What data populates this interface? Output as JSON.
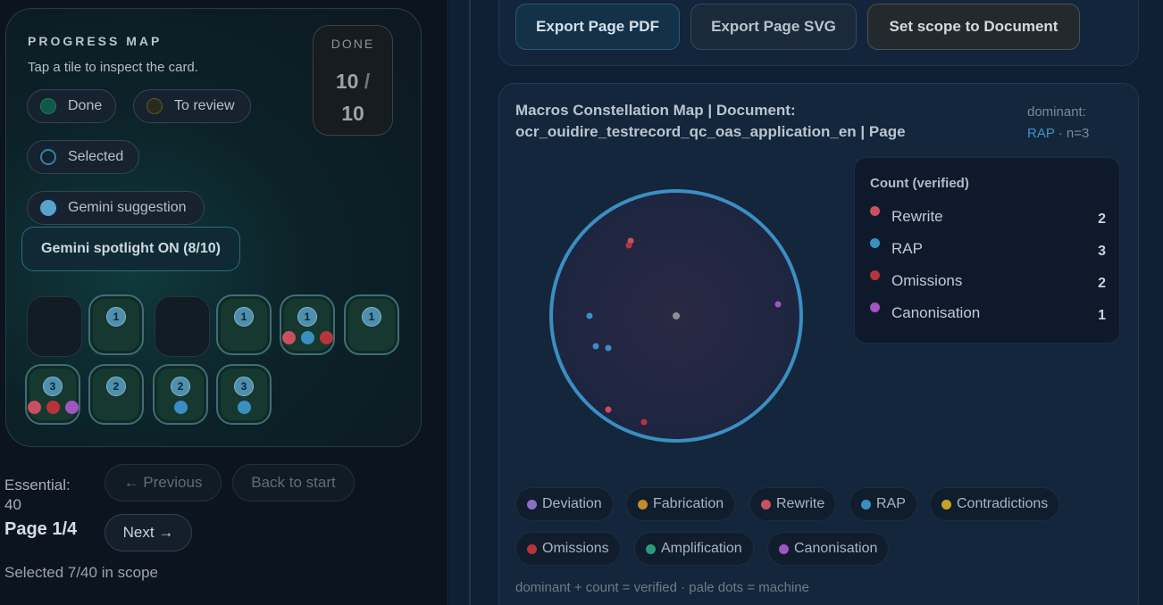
{
  "progress_map": {
    "title": "PROGRESS MAP",
    "subtitle": "Tap a tile to inspect the card.",
    "done_label": "DONE",
    "done_value": "10",
    "done_slash": "/",
    "done_total": "10",
    "legend": {
      "done": "Done",
      "to_review": "To review",
      "selected": "Selected",
      "gemini": "Gemini suggestion"
    },
    "spotlight_label": "Gemini spotlight ON (8/10)",
    "tiles": [
      {
        "badge": ""
      },
      {
        "badge": "1"
      },
      {
        "badge": ""
      },
      {
        "badge": "1"
      },
      {
        "badge": "1"
      },
      {
        "badge": "1"
      },
      {
        "badge": "3"
      },
      {
        "badge": "2"
      },
      {
        "badge": "2"
      },
      {
        "badge": "3"
      }
    ]
  },
  "nav": {
    "essential_label": "Essential:",
    "essential_value": "40",
    "page_indicator": "Page 1/4",
    "previous_label": "← Previous",
    "back_to_start_label": "Back to start",
    "next_label": "Next →",
    "selected_scope": "Selected 7/40 in scope"
  },
  "toolbar": {
    "export_pdf": "Export Page PDF",
    "export_svg": "Export Page SVG",
    "set_scope": "Set scope to Document"
  },
  "map": {
    "title_line1": "Macros Constellation Map | Document:",
    "title_line2": "ocr_ouidire_testrecord_qc_oas_application_en | Page",
    "dominant_label": "dominant:",
    "dominant_value": "RAP",
    "dominant_n": "· n=3",
    "count_title": "Count (verified)",
    "counts": [
      {
        "label": "Rewrite",
        "value": "2",
        "color": "#c9505e"
      },
      {
        "label": "RAP",
        "value": "3",
        "color": "#3a8fc2"
      },
      {
        "label": "Omissions",
        "value": "2",
        "color": "#b8343b"
      },
      {
        "label": "Canonisation",
        "value": "1",
        "color": "#a155c0"
      }
    ],
    "legend": [
      {
        "label": "Deviation",
        "color": "#8a6fc0"
      },
      {
        "label": "Fabrication",
        "color": "#c48a2a"
      },
      {
        "label": "Rewrite",
        "color": "#c9505e"
      },
      {
        "label": "RAP",
        "color": "#3a8fc2"
      },
      {
        "label": "Contradictions",
        "color": "#c9a323"
      },
      {
        "label": "Omissions",
        "color": "#b8343b"
      },
      {
        "label": "Amplification",
        "color": "#2a9c78"
      },
      {
        "label": "Canonisation",
        "color": "#a155c0"
      }
    ],
    "footnote": "dominant + count = verified · pale dots = machine"
  },
  "colors": {
    "rewrite": "#c9505e",
    "rap": "#3a8fc2",
    "omissions": "#b8343b",
    "canonisation": "#a155c0",
    "ring": "#3a8fc2"
  }
}
